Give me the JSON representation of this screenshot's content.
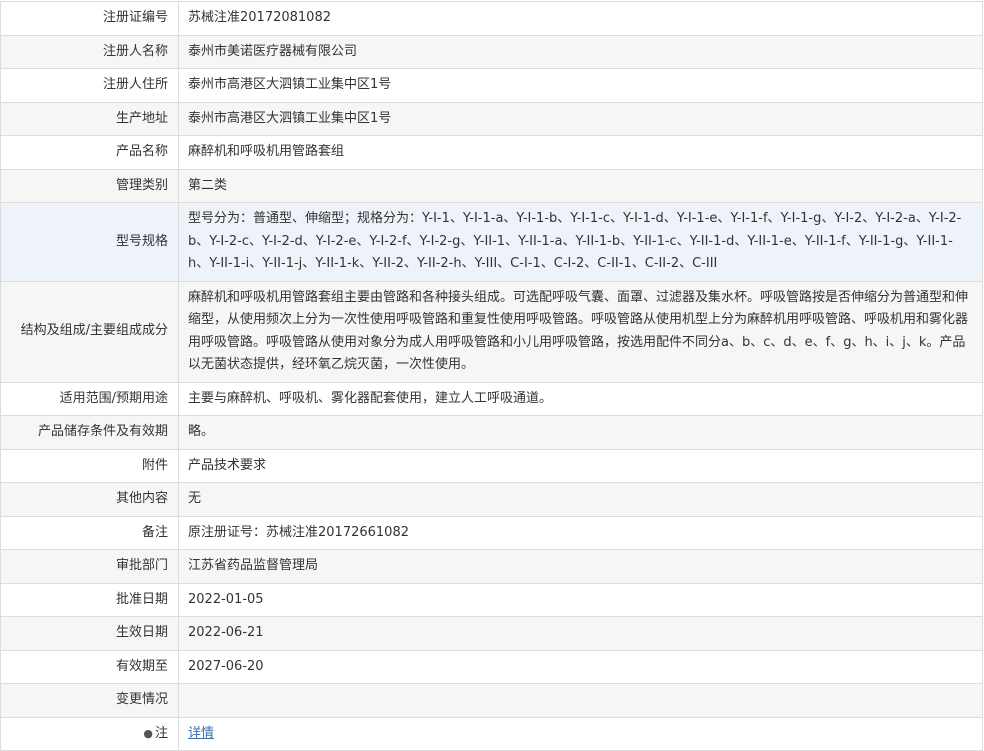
{
  "rows": [
    {
      "label": "注册证编号",
      "value": "苏械注准20172081082"
    },
    {
      "label": "注册人名称",
      "value": "泰州市美诺医疗器械有限公司"
    },
    {
      "label": "注册人住所",
      "value": "泰州市高港区大泗镇工业集中区1号"
    },
    {
      "label": "生产地址",
      "value": "泰州市高港区大泗镇工业集中区1号"
    },
    {
      "label": "产品名称",
      "value": "麻醉机和呼吸机用管路套组"
    },
    {
      "label": "管理类别",
      "value": "第二类"
    },
    {
      "label": "型号规格",
      "value": "型号分为：普通型、伸缩型；规格分为：Y-I-1、Y-I-1-a、Y-I-1-b、Y-I-1-c、Y-I-1-d、Y-I-1-e、Y-I-1-f、Y-I-1-g、Y-I-2、Y-I-2-a、Y-I-2-b、Y-I-2-c、Y-I-2-d、Y-I-2-e、Y-I-2-f、Y-I-2-g、Y-II-1、Y-II-1-a、Y-II-1-b、Y-II-1-c、Y-II-1-d、Y-II-1-e、Y-II-1-f、Y-II-1-g、Y-II-1-h、Y-II-1-i、Y-II-1-j、Y-II-1-k、Y-II-2、Y-II-2-h、Y-III、C-I-1、C-I-2、C-II-1、C-II-2、C-III"
    },
    {
      "label": "结构及组成/主要组成成分",
      "value": "麻醉机和呼吸机用管路套组主要由管路和各种接头组成。可选配呼吸气囊、面罩、过滤器及集水杯。呼吸管路按是否伸缩分为普通型和伸缩型，从使用频次上分为一次性使用呼吸管路和重复性使用呼吸管路。呼吸管路从使用机型上分为麻醉机用呼吸管路、呼吸机用和雾化器用呼吸管路。呼吸管路从使用对象分为成人用呼吸管路和小儿用呼吸管路，按选用配件不同分a、b、c、d、e、f、g、h、i、j、k。产品以无菌状态提供，经环氧乙烷灭菌，一次性使用。"
    },
    {
      "label": "适用范围/预期用途",
      "value": "主要与麻醉机、呼吸机、雾化器配套使用，建立人工呼吸通道。"
    },
    {
      "label": "产品储存条件及有效期",
      "value": "略。"
    },
    {
      "label": "附件",
      "value": "产品技术要求"
    },
    {
      "label": "其他内容",
      "value": "无"
    },
    {
      "label": "备注",
      "value": "原注册证号：苏械注准20172661082"
    },
    {
      "label": "审批部门",
      "value": "江苏省药品监督管理局"
    },
    {
      "label": "批准日期",
      "value": "2022-01-05"
    },
    {
      "label": "生效日期",
      "value": "2022-06-21"
    },
    {
      "label": "有效期至",
      "value": "2027-06-20"
    },
    {
      "label": "变更情况",
      "value": ""
    }
  ],
  "note_row": {
    "bullet": "●",
    "label": "注",
    "link": "详情"
  }
}
